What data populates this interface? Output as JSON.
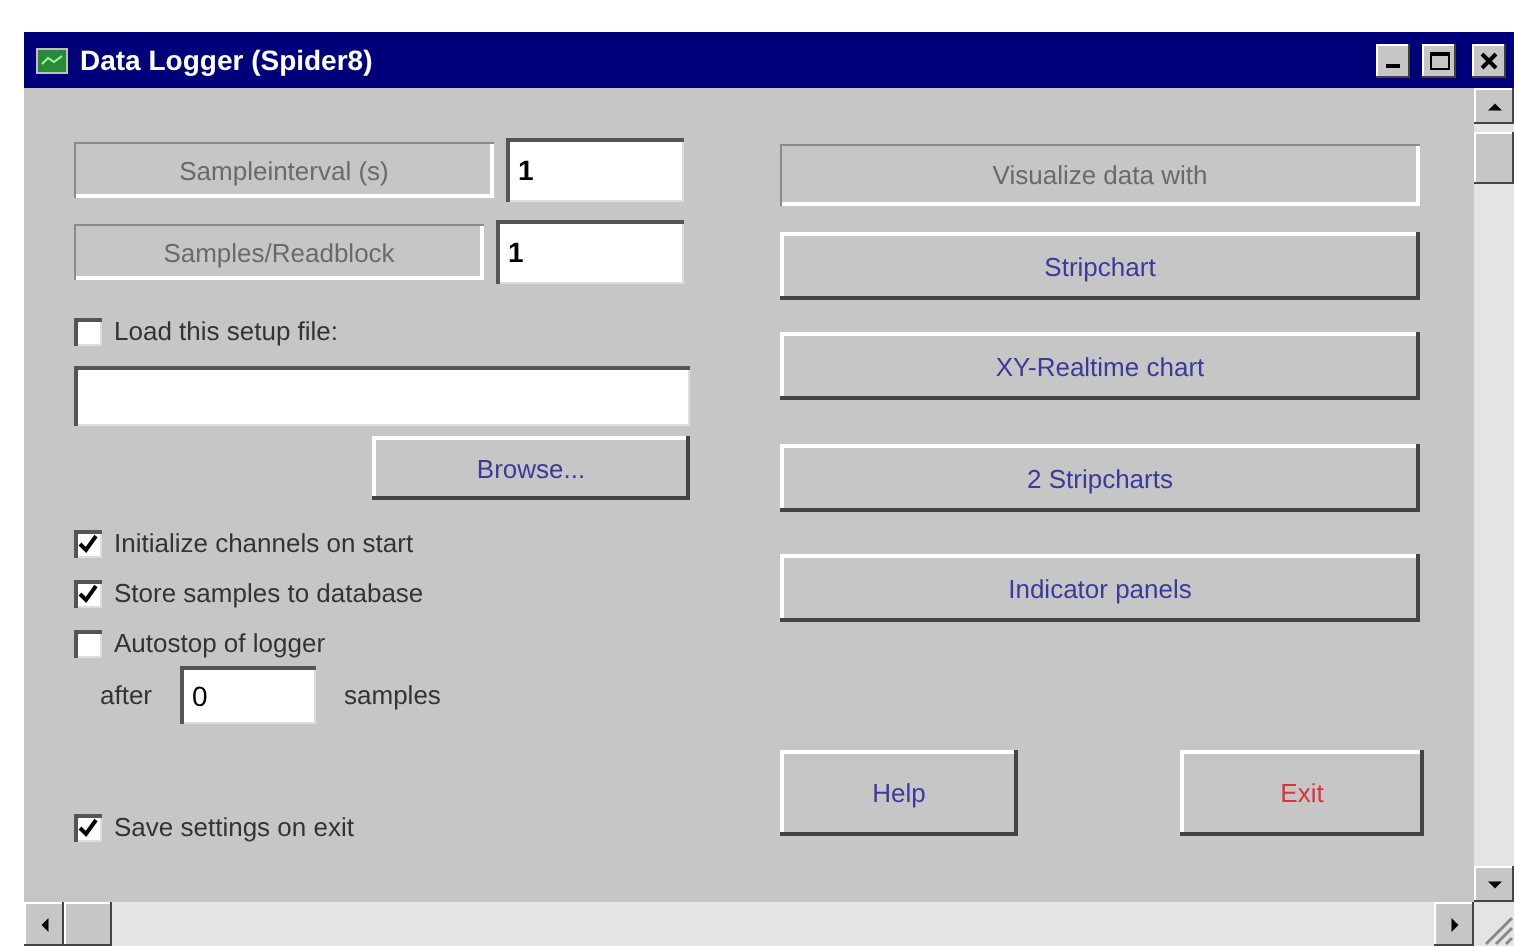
{
  "window": {
    "title": "Data Logger (Spider8)"
  },
  "settings": [
    {
      "label": "Sampleinterval (s)",
      "value": "1"
    },
    {
      "label": "Samples/Readblock",
      "value": "1"
    }
  ],
  "setup_file": {
    "label": "Load this setup file:",
    "checked": false,
    "browse_button": "Browse..."
  },
  "options": [
    {
      "label": "Initialize channels on start",
      "checked": true
    },
    {
      "label": "Store samples to database",
      "checked": true
    },
    {
      "label": "Autostop of logger",
      "checked": false
    }
  ],
  "autostop": {
    "prefix": "after",
    "value": "0",
    "suffix": "samples"
  },
  "save_settings": {
    "label": "Save settings on exit",
    "checked": true
  },
  "visualize": {
    "heading": "Visualize data with",
    "buttons": [
      "Stripchart",
      "XY-Realtime chart",
      "2 Stripcharts",
      "Indicator panels"
    ]
  },
  "actions": [
    {
      "label": "Help",
      "kind": "normal"
    },
    {
      "label": "Exit",
      "kind": "danger"
    }
  ]
}
